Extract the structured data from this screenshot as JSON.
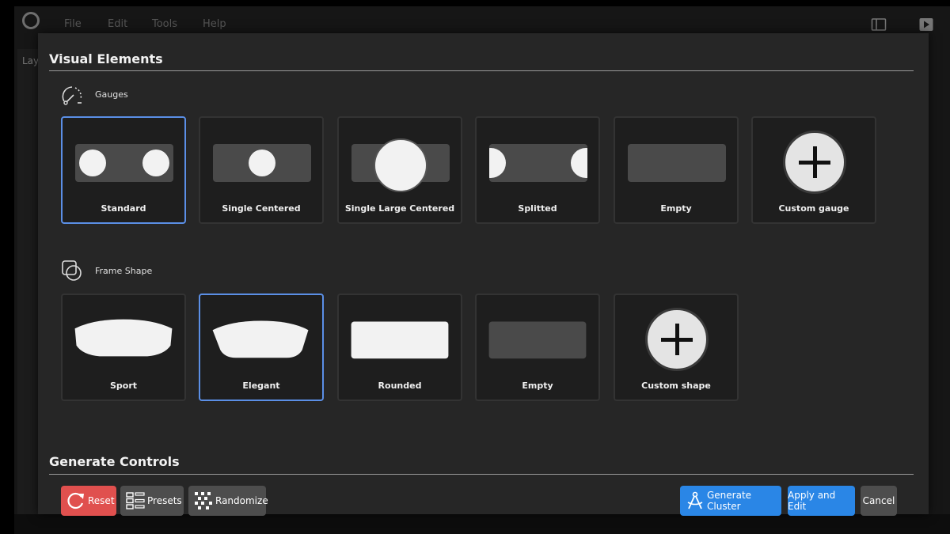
{
  "menubar": {
    "items": [
      "File",
      "Edit",
      "Tools",
      "Help"
    ]
  },
  "side_panel": {
    "label": "Lay"
  },
  "dialog": {
    "visual_elements_title": "Visual Elements",
    "gauges": {
      "label": "Gauges",
      "options": [
        {
          "label": "Standard",
          "selected": true
        },
        {
          "label": "Single Centered",
          "selected": false
        },
        {
          "label": "Single Large Centered",
          "selected": false
        },
        {
          "label": "Splitted",
          "selected": false
        },
        {
          "label": "Empty",
          "selected": false
        },
        {
          "label": "Custom gauge",
          "selected": false
        }
      ]
    },
    "frame_shape": {
      "label": "Frame Shape",
      "options": [
        {
          "label": "Sport",
          "selected": false
        },
        {
          "label": "Elegant",
          "selected": true
        },
        {
          "label": "Rounded",
          "selected": false
        },
        {
          "label": "Empty",
          "selected": false
        },
        {
          "label": "Custom shape",
          "selected": false
        }
      ]
    },
    "generate_controls_title": "Generate Controls",
    "buttons": {
      "reset": "Reset",
      "presets": "Presets",
      "randomize": "Randomize",
      "generate_cluster": "Generate Cluster",
      "apply_and_edit": "Apply and Edit",
      "cancel": "Cancel"
    }
  },
  "colors": {
    "accent_blue": "#2a86e6",
    "selected_border": "#5b8fe6",
    "reset_red": "#e0504e",
    "dialog_bg": "#262626"
  }
}
